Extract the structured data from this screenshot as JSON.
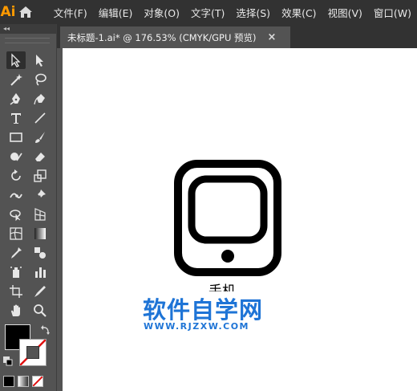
{
  "app": {
    "logo_text": "Ai"
  },
  "menu": [
    "文件(F)",
    "编辑(E)",
    "对象(O)",
    "文字(T)",
    "选择(S)",
    "效果(C)",
    "视图(V)",
    "窗口(W)"
  ],
  "toolbar": {
    "collapse_label": "◂◂"
  },
  "document_tab": {
    "title": "未标题-1.ai* @ 176.53% (CMYK/GPU 预览)",
    "close_label": "×"
  },
  "canvas": {
    "icon_caption": "手机",
    "watermark_text": "软件自学网",
    "watermark_url": "WWW.RJZXW.COM"
  },
  "colors": {
    "menubar_bg": "#323232",
    "panel_bg": "#535353",
    "logo": "#ff9a00",
    "watermark": "#1e74d6"
  }
}
